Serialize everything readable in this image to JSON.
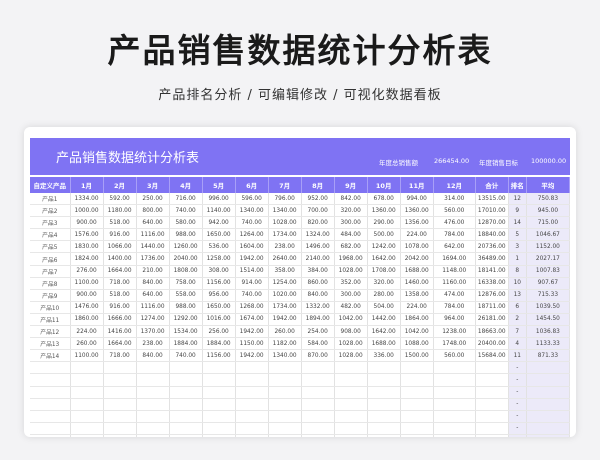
{
  "page": {
    "title": "产品销售数据统计分析表",
    "subtitle": "产品排名分析 / 可编辑修改 / 可视化数据看板"
  },
  "sheet": {
    "title": "产品销售数据统计分析表",
    "annual_total_label": "年度总销售额",
    "annual_total_value": "266454.00",
    "annual_target_label": "年度销售目标",
    "annual_target_value": "100000.00",
    "headers": [
      "自定义产品",
      "1月",
      "2月",
      "3月",
      "4月",
      "5月",
      "6月",
      "7月",
      "8月",
      "9月",
      "10月",
      "11月",
      "12月",
      "合计",
      "排名",
      "平均"
    ],
    "rows": [
      [
        "产品1",
        "1334.00",
        "592.00",
        "250.00",
        "716.00",
        "996.00",
        "596.00",
        "796.00",
        "952.00",
        "842.00",
        "678.00",
        "994.00",
        "314.00",
        "13515.00",
        "12",
        "750.83"
      ],
      [
        "产品2",
        "1000.00",
        "1180.00",
        "800.00",
        "740.00",
        "1140.00",
        "1340.00",
        "1340.00",
        "700.00",
        "320.00",
        "1360.00",
        "1360.00",
        "560.00",
        "17010.00",
        "9",
        "945.00"
      ],
      [
        "产品3",
        "900.00",
        "518.00",
        "640.00",
        "580.00",
        "942.00",
        "740.00",
        "1028.00",
        "820.00",
        "300.00",
        "290.00",
        "1356.00",
        "476.00",
        "12870.00",
        "14",
        "715.00"
      ],
      [
        "产品4",
        "1576.00",
        "916.00",
        "1116.00",
        "988.00",
        "1650.00",
        "1264.00",
        "1734.00",
        "1324.00",
        "484.00",
        "500.00",
        "224.00",
        "784.00",
        "18840.00",
        "5",
        "1046.67"
      ],
      [
        "产品5",
        "1830.00",
        "1066.00",
        "1440.00",
        "1260.00",
        "536.00",
        "1604.00",
        "238.00",
        "1496.00",
        "682.00",
        "1242.00",
        "1078.00",
        "642.00",
        "20736.00",
        "3",
        "1152.00"
      ],
      [
        "产品6",
        "1824.00",
        "1400.00",
        "1736.00",
        "2040.00",
        "1258.00",
        "1942.00",
        "2640.00",
        "2140.00",
        "1968.00",
        "1642.00",
        "2042.00",
        "1694.00",
        "36489.00",
        "1",
        "2027.17"
      ],
      [
        "产品7",
        "276.00",
        "1664.00",
        "210.00",
        "1808.00",
        "308.00",
        "1514.00",
        "358.00",
        "384.00",
        "1028.00",
        "1708.00",
        "1688.00",
        "1148.00",
        "18141.00",
        "8",
        "1007.83"
      ],
      [
        "产品8",
        "1100.00",
        "718.00",
        "840.00",
        "758.00",
        "1156.00",
        "914.00",
        "1254.00",
        "860.00",
        "352.00",
        "320.00",
        "1460.00",
        "1160.00",
        "16338.00",
        "10",
        "907.67"
      ],
      [
        "产品9",
        "900.00",
        "518.00",
        "640.00",
        "558.00",
        "956.00",
        "740.00",
        "1020.00",
        "840.00",
        "300.00",
        "280.00",
        "1358.00",
        "474.00",
        "12876.00",
        "13",
        "715.33"
      ],
      [
        "产品10",
        "1476.00",
        "916.00",
        "1116.00",
        "988.00",
        "1650.00",
        "1268.00",
        "1734.00",
        "1332.00",
        "482.00",
        "504.00",
        "224.00",
        "784.00",
        "18711.00",
        "6",
        "1039.50"
      ],
      [
        "产品11",
        "1860.00",
        "1666.00",
        "1274.00",
        "1292.00",
        "1016.00",
        "1674.00",
        "1942.00",
        "1894.00",
        "1042.00",
        "1442.00",
        "1864.00",
        "964.00",
        "26181.00",
        "2",
        "1454.50"
      ],
      [
        "产品12",
        "224.00",
        "1416.00",
        "1370.00",
        "1534.00",
        "256.00",
        "1942.00",
        "260.00",
        "254.00",
        "908.00",
        "1642.00",
        "1042.00",
        "1238.00",
        "18663.00",
        "7",
        "1036.83"
      ],
      [
        "产品13",
        "260.00",
        "1664.00",
        "238.00",
        "1884.00",
        "1884.00",
        "1150.00",
        "1182.00",
        "584.00",
        "1028.00",
        "1688.00",
        "1088.00",
        "1748.00",
        "20400.00",
        "4",
        "1133.33"
      ],
      [
        "产品14",
        "1100.00",
        "718.00",
        "840.00",
        "740.00",
        "1156.00",
        "1942.00",
        "1340.00",
        "870.00",
        "1028.00",
        "336.00",
        "1500.00",
        "560.00",
        "15684.00",
        "11",
        "871.33"
      ]
    ],
    "empty_row_count": 8,
    "empty_rank_mark": "-"
  }
}
